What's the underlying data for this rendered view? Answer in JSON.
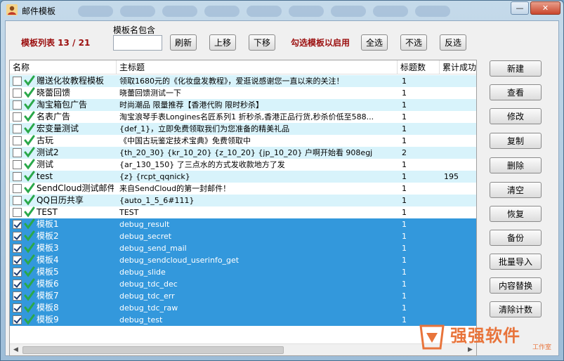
{
  "window": {
    "title": "邮件模板",
    "minimize": "—",
    "close": "✕"
  },
  "toolbar": {
    "list_label": "模板列表 13 / 21",
    "filter_label": "模板名包含",
    "filter_value": "",
    "refresh": "刷新",
    "move_up": "上移",
    "move_down": "下移",
    "enable_hint": "勾选模板以启用",
    "select_all": "全选",
    "select_none": "不选",
    "invert": "反选"
  },
  "table": {
    "columns": [
      "名称",
      "主标题",
      "标题数",
      "累计成功"
    ],
    "rows": [
      {
        "checked": false,
        "name": "赠送化妆教程模板",
        "subject": "领取1680元的《化妆盘发教程》，爱逛说感谢您一直以来的关注！",
        "count": "1",
        "total": "",
        "style": "alt"
      },
      {
        "checked": false,
        "name": "晓蕾回馈",
        "subject": "晓蕾回馈测试一下",
        "count": "1",
        "total": "",
        "style": "plain"
      },
      {
        "checked": false,
        "name": "淘宝箱包广告",
        "subject": "时尚潮品 限量推荐【香港代购 限时秒杀】",
        "count": "1",
        "total": "",
        "style": "alt"
      },
      {
        "checked": false,
        "name": "名表广告",
        "subject": "淘宝浪琴手表Longines名匠系列1 折秒杀,香港正品行货,秒杀价低至588...",
        "count": "1",
        "total": "",
        "style": "plain"
      },
      {
        "checked": false,
        "name": "宏变量测试",
        "subject": "{def_1}，立即免费领取我们为您准备的精美礼品",
        "count": "1",
        "total": "",
        "style": "alt"
      },
      {
        "checked": false,
        "name": "古玩",
        "subject": "《中国古玩鉴定技术宝典》免费领取中",
        "count": "1",
        "total": "",
        "style": "plain"
      },
      {
        "checked": false,
        "name": "测试2",
        "subject": "{th_20_30} {kr_10_20} {z_10_20} {jp_10_20} 户啊开始看 908egj",
        "count": "2",
        "total": "",
        "style": "alt"
      },
      {
        "checked": false,
        "name": "测试",
        "subject": "{ar_130_150} 了三点水的方式发收款地方了发",
        "count": "1",
        "total": "",
        "style": "plain"
      },
      {
        "checked": false,
        "name": "test",
        "subject": "{z} {rcpt_qqnick}",
        "count": "1",
        "total": "195",
        "style": "alt"
      },
      {
        "checked": false,
        "name": "SendCloud测试邮件",
        "subject": "来自SendCloud的第一封邮件！",
        "count": "1",
        "total": "",
        "style": "plain"
      },
      {
        "checked": false,
        "name": "QQ日历共享",
        "subject": "{auto_1_5_6#111}",
        "count": "1",
        "total": "",
        "style": "alt"
      },
      {
        "checked": false,
        "name": "TEST",
        "subject": "TEST",
        "count": "1",
        "total": "",
        "style": "plain"
      },
      {
        "checked": true,
        "name": "模板1",
        "subject": "debug_result",
        "count": "1",
        "total": "",
        "style": "sel"
      },
      {
        "checked": true,
        "name": "模板2",
        "subject": "debug_secret",
        "count": "1",
        "total": "",
        "style": "sel"
      },
      {
        "checked": true,
        "name": "模板3",
        "subject": "debug_send_mail",
        "count": "1",
        "total": "",
        "style": "sel"
      },
      {
        "checked": true,
        "name": "模板4",
        "subject": "debug_sendcloud_userinfo_get",
        "count": "1",
        "total": "",
        "style": "sel"
      },
      {
        "checked": true,
        "name": "模板5",
        "subject": "debug_slide",
        "count": "1",
        "total": "",
        "style": "sel"
      },
      {
        "checked": true,
        "name": "模板6",
        "subject": "debug_tdc_dec",
        "count": "1",
        "total": "",
        "style": "sel"
      },
      {
        "checked": true,
        "name": "模板7",
        "subject": "debug_tdc_err",
        "count": "1",
        "total": "",
        "style": "sel"
      },
      {
        "checked": true,
        "name": "模板8",
        "subject": "debug_tdc_raw",
        "count": "1",
        "total": "",
        "style": "sel"
      },
      {
        "checked": true,
        "name": "模板9",
        "subject": "debug_test",
        "count": "1",
        "total": "",
        "style": "sel"
      }
    ]
  },
  "side_buttons": [
    "新建",
    "查看",
    "修改",
    "复制",
    "删除",
    "清空",
    "恢复",
    "备份",
    "批量导入",
    "内容替换",
    "清除计数"
  ],
  "watermark": {
    "main": "强强软件",
    "sub": "工作室"
  },
  "colors": {
    "selection": "#3398dc",
    "alt_row": "#d8f3fb",
    "accent_red": "#9b0f0f",
    "check_green": "#2aa84a"
  }
}
